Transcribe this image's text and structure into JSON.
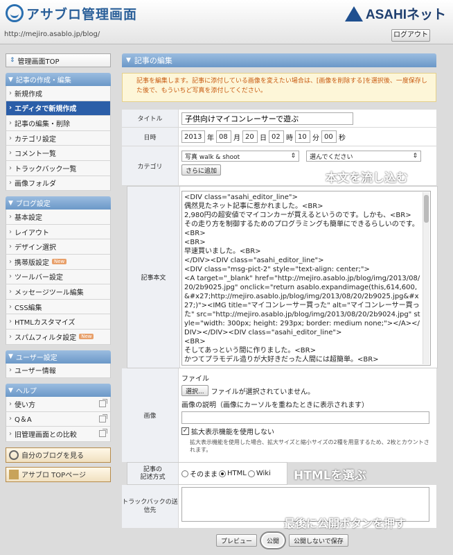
{
  "header": {
    "logo": "アサブロ管理画面",
    "brand": "ASAHIネット",
    "url": "http://mejiro.asablo.jp/blog/",
    "logout": "ログアウト"
  },
  "sidebar": {
    "top_link": "管理画面TOP",
    "sections": [
      {
        "title": "記事の作成・編集",
        "items": [
          {
            "label": "新規作成"
          },
          {
            "label": "エディタで新規作成",
            "active": true
          },
          {
            "label": "記事の編集・削除"
          },
          {
            "label": "カテゴリ設定"
          },
          {
            "label": "コメント一覧"
          },
          {
            "label": "トラックバック一覧"
          },
          {
            "label": "画像フォルダ"
          }
        ]
      },
      {
        "title": "ブログ設定",
        "items": [
          {
            "label": "基本設定"
          },
          {
            "label": "レイアウト"
          },
          {
            "label": "デザイン選択"
          },
          {
            "label": "携帯版設定",
            "badge": "New"
          },
          {
            "label": "ツールバー設定"
          },
          {
            "label": "メッセージツール編集"
          },
          {
            "label": "CSS編集"
          },
          {
            "label": "HTMLカスタマイズ"
          },
          {
            "label": "スパムフィルタ設定",
            "badge": "New"
          }
        ]
      },
      {
        "title": "ユーザー設定",
        "items": [
          {
            "label": "ユーザー情報"
          }
        ]
      },
      {
        "title": "ヘルプ",
        "items": [
          {
            "label": "使い方",
            "ext": true
          },
          {
            "label": "Q＆A",
            "ext": true
          },
          {
            "label": "旧管理画面との比較",
            "ext": true
          }
        ]
      }
    ],
    "view_blog": "自分のブログを見る",
    "asablo_top": "アサブロ TOPページ"
  },
  "main": {
    "heading": "記事の編集",
    "notice": "記事を編集します。記事に添付している画像を変えたい場合は、[画像を削除する]を選択後、一度保存した後で、もういちど写真を添付してください。",
    "title_label": "タイトル",
    "title_value": "子供向けマイコンレーサーで遊ぶ",
    "date_label": "日時",
    "date": {
      "year": "2013",
      "year_u": "年",
      "month": "08",
      "month_u": "月",
      "day": "20",
      "day_u": "日",
      "hour": "02",
      "hour_u": "時",
      "min": "10",
      "min_u": "分",
      "sec": "00",
      "sec_u": "秒"
    },
    "category_label": "カテゴリ",
    "category_select": "写真 walk & shoot",
    "category_select2": "選んでください",
    "category_add": "さらに追加",
    "body_label": "記事本文",
    "body_lines": [
      "<DIV class=\"asahi_editor_line\">",
      "偶然見たネット記事に惹かれました。<BR>",
      "2,980円の超安値でマイコンカーが買えるというのです。しかも、<BR>",
      "その走り方を制御するためのプログラミングも簡単にできるらしいのです。<BR>",
      "<BR>",
      "早速買いました。<BR>",
      "</DIV><DIV class=\"asahi_editor_line\">",
      "<DIV class=\"msg-pict-2\" style=\"text-align: center;\">",
      "<A target=\"_blank\" href=\"http://mejiro.asablo.jp/blog/img/2013/08/20/2b9025.jpg\" onclick=\"return asablo.expandimage(this,614,600,&#x27;http://mejiro.asablo.jp/blog/img/2013/08/20/2b9025.jpg&#x27;)\"><IMG title=\"マイコンレーサー買った\" alt=\"マイコンレーサー買った\" src=\"http://mejiro.asablo.jp/blog/img/2013/08/20/2b9024.jpg\" style=\"width: 300px; height: 293px; border: medium none;\"></A></DIV></DIV><DIV class=\"asahi_editor_line\">",
      "<BR>",
      "そしてあっという間に作りました。<BR>",
      "かつてプラモデル造りが大好きだった人間には超簡単。<BR>"
    ],
    "image_label": "画像",
    "file_label": "ファイル",
    "file_button": "選択...",
    "file_none": "ファイルが選択されていません。",
    "image_desc_label": "画像の説明（画像にカーソルを重ねたときに表示されます）",
    "zoom_check": "拡大表示機能を使用しない",
    "zoom_note": "拡大表示機能を使用した場合、拡大サイズと縮小サイズの2種を用意するため、2枚とカウントされます。",
    "format_label1": "記事の",
    "format_label2": "記述方式",
    "format_options": [
      "そのまま",
      "HTML",
      "Wiki"
    ],
    "format_selected": "HTML",
    "trackback_label": "トラックバックの送信先",
    "preview_button": "プレビュー",
    "publish_button": "公開",
    "save_button": "公開しないで保存"
  },
  "annotations": {
    "body": "本文を流し込む",
    "html": "HTMLを選ぶ",
    "publish": "最後に公開ボタンを押す"
  }
}
